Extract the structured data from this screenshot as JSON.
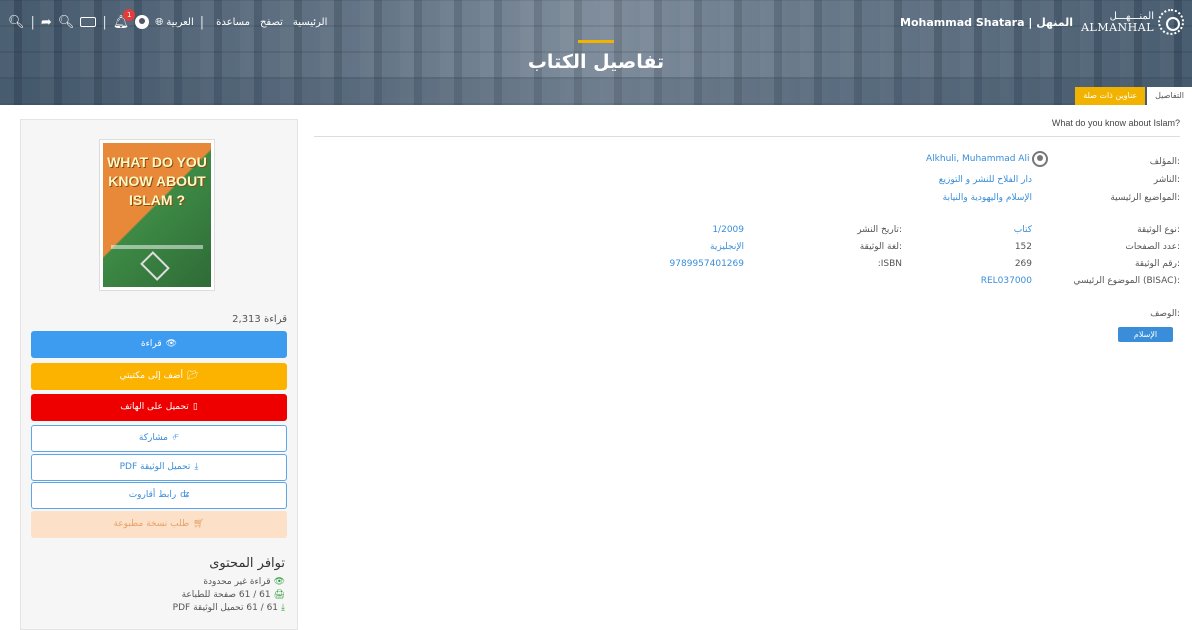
{
  "header": {
    "title": "تفاصيل الكتاب",
    "user_name": "Mohammad Shatara | المنهل",
    "logo_en": "ALMANHAL",
    "logo_ar": "المنـــهـــل",
    "language": "العربية",
    "nav": [
      "الرئيسية",
      "تصفح",
      "مساعدة"
    ],
    "notification_count": "1"
  },
  "tabs": [
    "التفاصيل",
    "عناوين ذات صلة"
  ],
  "document": {
    "title": "What do you know about Islam?",
    "fields": {
      "author_label": "المؤلف:",
      "author": "Alkhuli, Muhammad Ali",
      "publisher_label": "الناشر:",
      "publisher": "دار الفلاح للنشر و التوزيع",
      "subjects_label": "المواضيع الرئيسية:",
      "subjects": "الإسلام واليهودية والنيابة",
      "doc_type_label": "نوع الوثيقة:",
      "doc_type": "كتاب",
      "pages_label": "عدد الصفحات:",
      "pages": "152",
      "doc_number_label": "رقم الوثيقة:",
      "doc_number": "269",
      "bisac_label": "الموضوع الرئيسي (BISAC):",
      "bisac": "REL037000",
      "pub_date_label": "تاريخ النشر:",
      "pub_date": "1/2009",
      "doc_lang_label": "لغة الوثيقة:",
      "doc_lang": "الإنجليزية",
      "isbn_label": ":ISBN",
      "isbn": "9789957401269",
      "description_label": "الوصف:",
      "tag": "الإسلام"
    }
  },
  "sidebar": {
    "cover_text": "WHAT DO YOU KNOW ABOUT ISLAM ?",
    "reads": "2,313 قراءة",
    "buttons": {
      "read": "قراءة",
      "add_library": "أضف إلى مكتبتي",
      "download_phone": "تحميل على الهاتف",
      "share": "مشاركة",
      "download_pdf": "تحميل الوثيقة PDF",
      "arabic_link": "رابط أقاروت",
      "print_request": "طلب نسخة مطبوعة"
    },
    "availability": {
      "title": "توافر المحتوى",
      "unlimited": "قراءة غير محدودة",
      "print": "61 / 61 صفحة للطباعة",
      "pdf": "61 / 61 تحميل الوثيقة PDF"
    }
  },
  "colors": {
    "accent_blue": "#3d9cf0",
    "accent_yellow": "#fbb300",
    "accent_red": "#ef0000",
    "link": "#3a8ed9"
  }
}
